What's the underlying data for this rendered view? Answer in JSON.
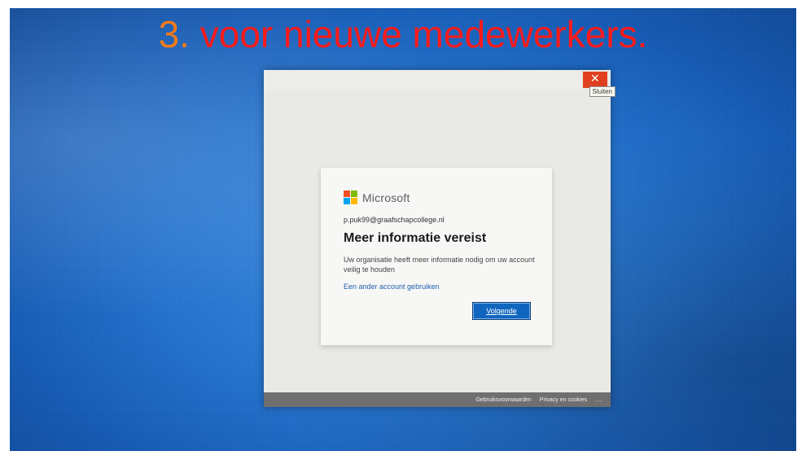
{
  "caption": {
    "number": "3.",
    "text": "voor nieuwe medewerkers."
  },
  "window": {
    "close_tooltip": "Sluiten"
  },
  "card": {
    "brand": "Microsoft",
    "email": "p.puk99@graafschapcollege.nl",
    "heading": "Meer informatie vereist",
    "description": "Uw organisatie heeft meer informatie nodig om uw account veilig te houden",
    "other_account_link": "Een ander account gebruiken",
    "next_button": "Volgende"
  },
  "footer": {
    "terms": "Gebruiksvoorwaarden",
    "privacy": "Privacy en cookies",
    "more": "..."
  },
  "colors": {
    "caption_number": "#f07a1a",
    "caption_text": "#ff1a1a",
    "close_button": "#e1401f",
    "primary_button": "#1066be",
    "link": "#1f5fae"
  }
}
